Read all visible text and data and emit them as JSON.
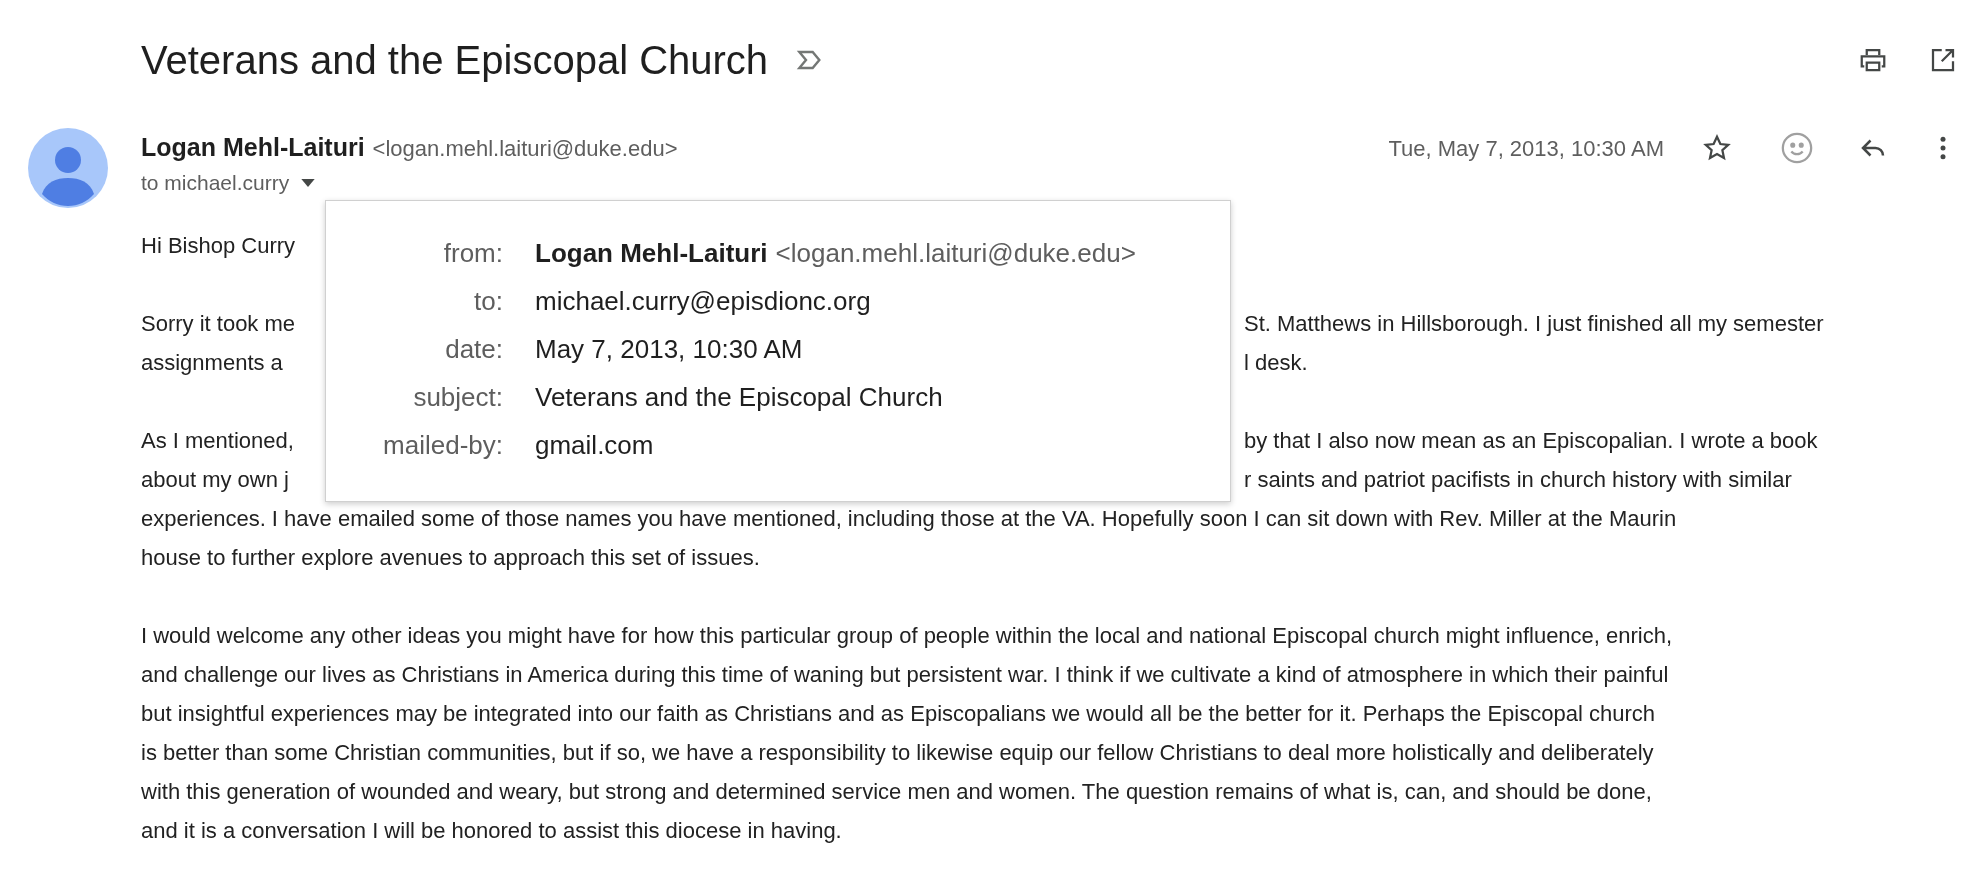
{
  "subject": "Veterans and the Episcopal Church",
  "sender": {
    "name": "Logan Mehl-Laituri",
    "email": "<logan.mehl.laituri@duke.edu>",
    "to": "to michael.curry",
    "date": "Tue, May 7, 2013, 10:30 AM",
    "starred": false
  },
  "details_popup": {
    "rows": [
      {
        "label": "from:",
        "name": "Logan Mehl-Laituri",
        "value": "<logan.mehl.laituri@duke.edu>"
      },
      {
        "label": "to:",
        "value": "michael.curry@episdionc.org"
      },
      {
        "label": "date:",
        "value": "May 7, 2013, 10:30 AM"
      },
      {
        "label": "subject:",
        "value": "Veterans and the Episcopal Church"
      },
      {
        "label": "mailed-by:",
        "value": "gmail.com"
      }
    ]
  },
  "body": {
    "paragraphs": [
      {
        "lines": [
          {
            "kind": "split",
            "left": "Hi Bishop Curry"
          }
        ]
      },
      {
        "lines": [
          {
            "kind": "split",
            "left": "Sorry it took me",
            "right": "St. Matthews in Hillsborough. I just finished all my semester"
          },
          {
            "kind": "split",
            "left": "assignments a",
            "right": "l desk."
          }
        ]
      },
      {
        "lines": [
          {
            "kind": "split",
            "left": "As I mentioned,",
            "right": "by that I also now mean as an Episcopalian. I wrote a book"
          },
          {
            "kind": "split",
            "left": "about my own j",
            "right": "r saints and patriot pacifists in church history with similar"
          },
          {
            "kind": "full",
            "text": "experiences. I have emailed some of those names you have mentioned, including those at the VA. Hopefully soon I can sit down with Rev. Miller at the Maurin"
          },
          {
            "kind": "full",
            "text": "house to further explore avenues to approach this set of issues."
          }
        ]
      },
      {
        "lines": [
          {
            "kind": "full",
            "text": "I would welcome any other ideas you might have for how this particular group of people within the local and national Episcopal church might influence, enrich,"
          },
          {
            "kind": "full",
            "text": "and challenge our lives as Christians in America during this time of waning but persistent war. I think if we cultivate a kind of atmosphere in which their painful"
          },
          {
            "kind": "full",
            "text": "but insightful experiences may be integrated into our faith as Christians and as Episcopalians  we would all be the better for it. Perhaps the Episcopal church"
          },
          {
            "kind": "full",
            "text": "is better than some Christian communities, but if so, we have a responsibility to likewise equip our fellow Christians to deal more holistically and deliberately"
          },
          {
            "kind": "full",
            "text": "with this generation of wounded and weary, but strong and determined service men and women. The question remains of what is, can, and should be done,"
          },
          {
            "kind": "full",
            "text": "and it is a conversation I will be honored to assist this diocese in having."
          }
        ]
      }
    ]
  }
}
